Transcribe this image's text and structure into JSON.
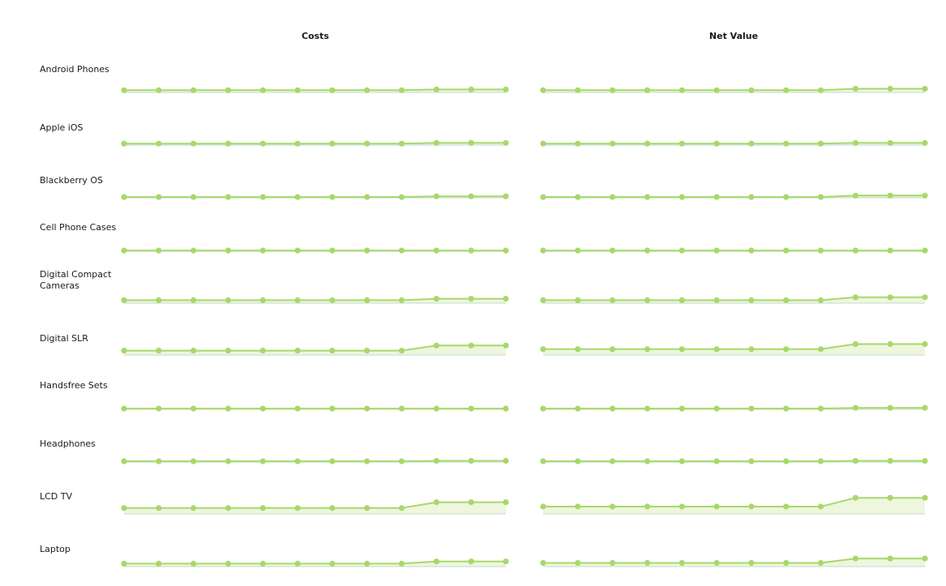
{
  "chart_data": {
    "type": "area",
    "columns": [
      "Costs",
      "Net Value"
    ],
    "points_per_series": 12,
    "colors": {
      "line": "#a8d86a",
      "fill": "#eef6dd",
      "marker": "#a8d86a",
      "baseline": "#cde0d8"
    },
    "rows": [
      {
        "label": "Android Phones",
        "costs": [
          3,
          3,
          3,
          3,
          3,
          3,
          3,
          3,
          3,
          4,
          4,
          4
        ],
        "net_value": [
          3,
          3,
          3,
          3,
          3,
          3,
          3,
          3,
          3,
          5,
          5,
          5
        ]
      },
      {
        "label": "Apple iOS",
        "costs": [
          2,
          2,
          2,
          2,
          2,
          2,
          2,
          2,
          2,
          3,
          3,
          3
        ],
        "net_value": [
          2,
          2,
          2,
          2,
          2,
          2,
          2,
          2,
          2,
          3,
          3,
          3
        ]
      },
      {
        "label": "Blackberry OS",
        "costs": [
          1,
          1,
          1,
          1,
          1,
          1,
          1,
          1,
          1,
          2,
          2,
          2
        ],
        "net_value": [
          1,
          1,
          1,
          1,
          1,
          1,
          1,
          1,
          1,
          3,
          3,
          3
        ]
      },
      {
        "label": "Cell Phone Cases",
        "costs": [
          1,
          1,
          1,
          1,
          1,
          1,
          1,
          1,
          1,
          1,
          1,
          1
        ],
        "net_value": [
          1,
          1,
          1,
          1,
          1,
          1,
          1,
          1,
          1,
          1,
          1,
          1
        ]
      },
      {
        "label": "Digital Compact Cameras",
        "costs": [
          4,
          4,
          4,
          4,
          4,
          4,
          4,
          4,
          4,
          6,
          6,
          6
        ],
        "net_value": [
          4,
          4,
          4,
          4,
          4,
          4,
          4,
          4,
          4,
          8,
          8,
          8
        ]
      },
      {
        "label": "Digital SLR",
        "costs": [
          6,
          6,
          6,
          6,
          6,
          6,
          6,
          6,
          6,
          13,
          13,
          13
        ],
        "net_value": [
          8,
          8,
          8,
          8,
          8,
          8,
          8,
          8,
          8,
          15,
          15,
          15
        ]
      },
      {
        "label": "Handsfree Sets",
        "costs": [
          1,
          1,
          1,
          1,
          1,
          1,
          1,
          1,
          1,
          1,
          1,
          1
        ],
        "net_value": [
          1,
          1,
          1,
          1,
          1,
          1,
          1,
          1,
          1,
          2,
          2,
          2
        ]
      },
      {
        "label": "Headphones",
        "costs": [
          1,
          1,
          1,
          1,
          1,
          1,
          1,
          1,
          1,
          1.5,
          1.5,
          1.5
        ],
        "net_value": [
          1,
          1,
          1,
          1,
          1,
          1,
          1,
          1,
          1,
          1.5,
          1.5,
          1.5
        ]
      },
      {
        "label": "LCD TV",
        "costs": [
          8,
          8,
          8,
          8,
          8,
          8,
          8,
          8,
          8,
          16,
          16,
          16
        ],
        "net_value": [
          10,
          10,
          10,
          10,
          10,
          10,
          10,
          10,
          10,
          22,
          22,
          22
        ]
      },
      {
        "label": "Laptop",
        "costs": [
          4,
          4,
          4,
          4,
          4,
          4,
          4,
          4,
          4,
          7,
          7,
          7
        ],
        "net_value": [
          5,
          5,
          5,
          5,
          5,
          5,
          5,
          5,
          5,
          11,
          11,
          11
        ]
      }
    ]
  }
}
